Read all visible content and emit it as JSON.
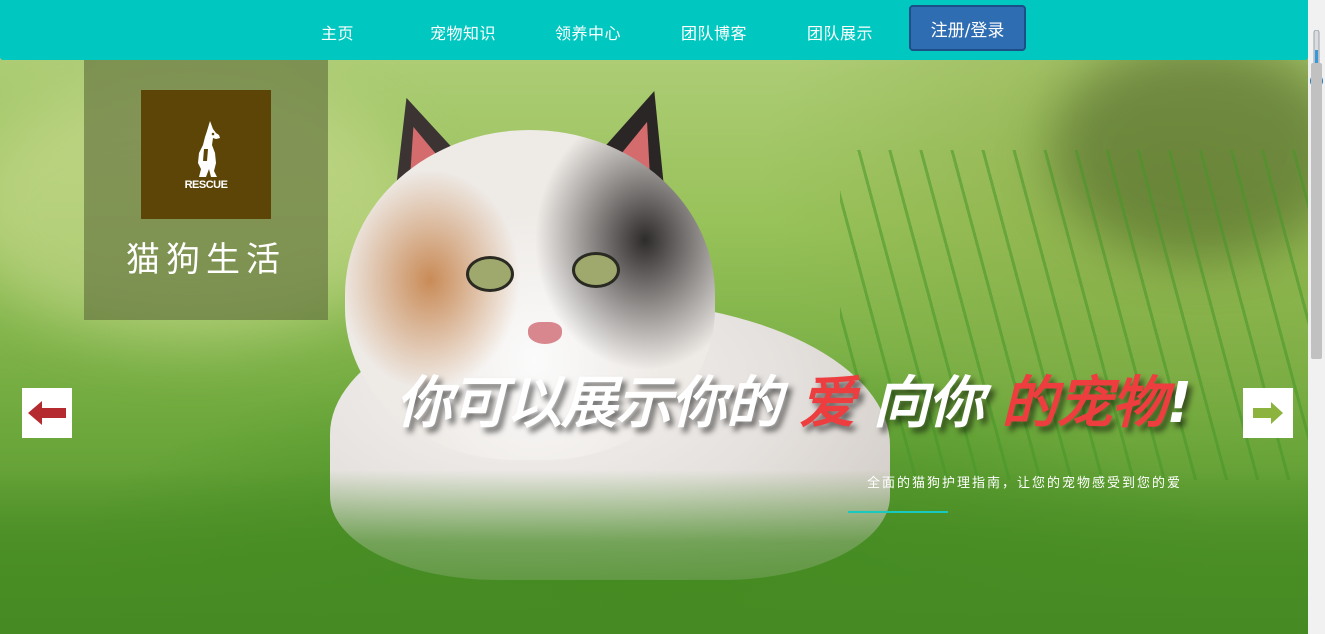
{
  "nav": {
    "items": [
      "主页",
      "宠物知识",
      "领养中心",
      "团队博客",
      "团队展示"
    ],
    "login_label": "注册/登录",
    "accent": "#00c8c0",
    "login_color": "#2f6db3"
  },
  "logo": {
    "emblem_text": "RESCUE",
    "site_name": "猫狗生活"
  },
  "hero": {
    "headline_part1": "你可以展示你的",
    "headline_red1": "爱",
    "headline_part2": "向你",
    "headline_red2": "的宠物",
    "headline_end": "!",
    "subtitle": "全面的猫狗护理指南，让您的宠物感受到您的爱",
    "highlight_color": "#ee3d3f",
    "underline_color": "#18c9bf"
  },
  "slider": {
    "prev_icon": "arrow-left-icon",
    "next_icon": "arrow-right-icon"
  }
}
